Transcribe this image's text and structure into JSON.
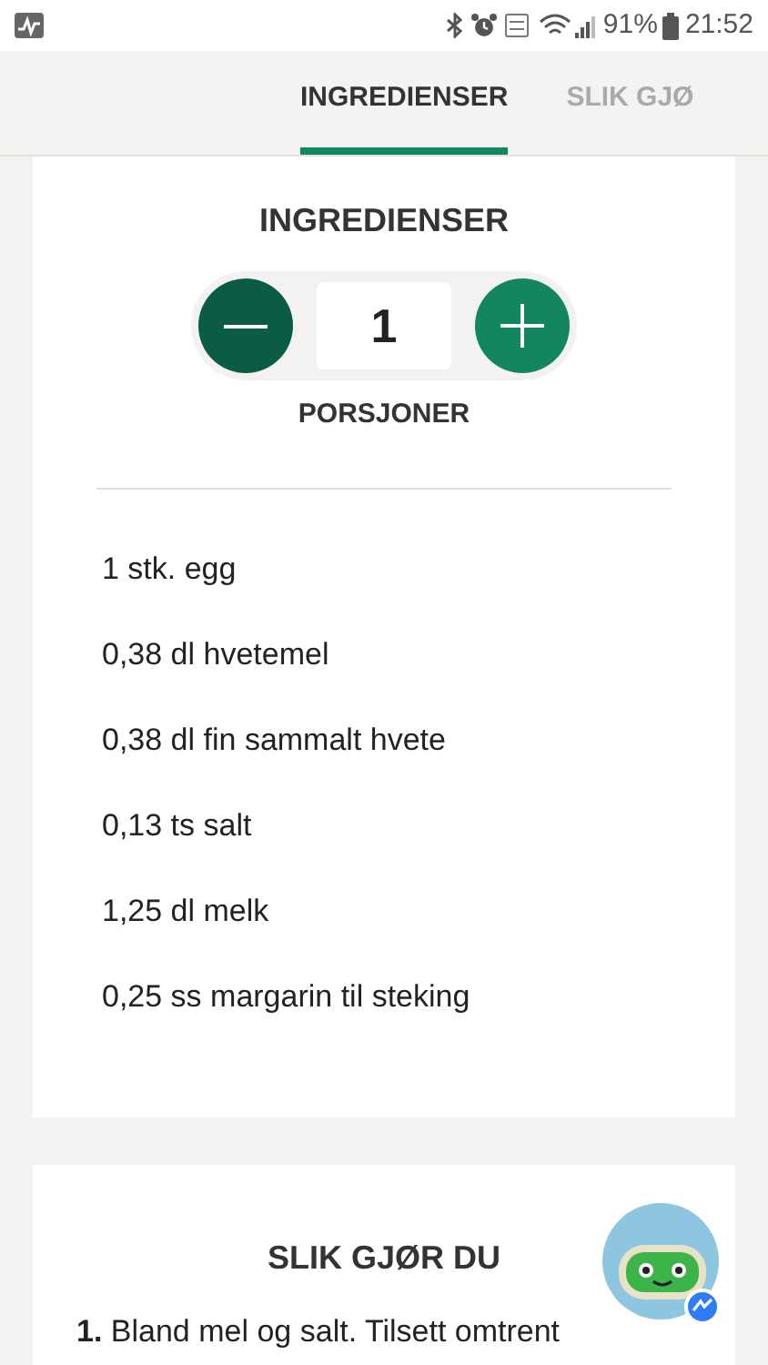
{
  "status_bar": {
    "battery": "91%",
    "time": "21:52"
  },
  "tabs": [
    {
      "label": "INGREDIENSER",
      "selected": true
    },
    {
      "label": "SLIK GJØ",
      "selected": false
    }
  ],
  "ingredients_card": {
    "title": "INGREDIENSER",
    "portions": {
      "value": "1",
      "label": "PORSJONER"
    },
    "items": [
      "1 stk. egg",
      "0,38 dl hvetemel",
      "0,38 dl fin sammalt hvete",
      "0,13 ts salt",
      "1,25 dl melk",
      "0,25 ss margarin til steking"
    ]
  },
  "steps_card": {
    "title": "SLIK GJØR DU",
    "steps": [
      "**1.** Bland mel og salt. Tilsett omtrent"
    ]
  }
}
